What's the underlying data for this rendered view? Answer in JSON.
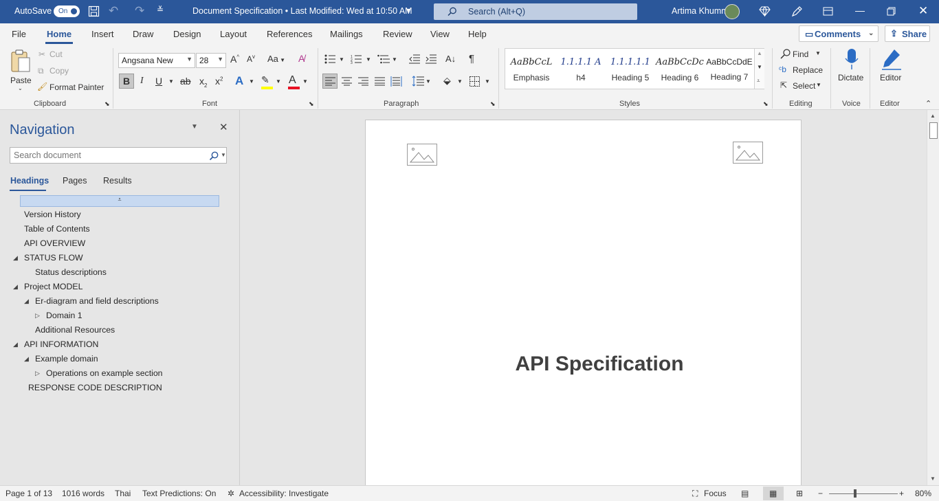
{
  "titlebar": {
    "autosave_label": "AutoSave",
    "autosave_state": "On",
    "doc_title": "Document Specification • Last Modified: Wed at 10:50 AM",
    "search_placeholder": "Search (Alt+Q)",
    "user_name": "Artima Khummee"
  },
  "menu": {
    "items": [
      "File",
      "Home",
      "Insert",
      "Draw",
      "Design",
      "Layout",
      "References",
      "Mailings",
      "Review",
      "View",
      "Help"
    ],
    "active": "Home",
    "comments_label": "Comments",
    "share_label": "Share"
  },
  "ribbon": {
    "clipboard": {
      "paste": "Paste",
      "cut": "Cut",
      "copy": "Copy",
      "format_painter": "Format Painter",
      "label": "Clipboard"
    },
    "font": {
      "name": "Angsana New",
      "size": "28",
      "label": "Font",
      "case_label": "Aa"
    },
    "paragraph": {
      "label": "Paragraph"
    },
    "styles": {
      "label": "Styles",
      "items": [
        {
          "preview": "AaBbCcL",
          "name": "Emphasis"
        },
        {
          "preview": "1.1.1.1 A",
          "name": "h4"
        },
        {
          "preview": "1.1.1.1.1",
          "name": "Heading 5"
        },
        {
          "preview": "AaBbCcDc",
          "name": "Heading 6"
        },
        {
          "preview": "AaBbCcDdE",
          "name": "Heading 7"
        }
      ]
    },
    "editing": {
      "find": "Find",
      "replace": "Replace",
      "select": "Select",
      "label": "Editing"
    },
    "voice": {
      "dictate": "Dictate",
      "label": "Voice"
    },
    "editor": {
      "editor": "Editor",
      "label": "Editor"
    },
    "colors": {
      "highlight": "#ffff00",
      "font_color": "#e81123",
      "accent": "#2b579a"
    }
  },
  "nav": {
    "title": "Navigation",
    "search_placeholder": "Search document",
    "tabs": [
      "Headings",
      "Pages",
      "Results"
    ],
    "active_tab": "Headings",
    "headings": [
      {
        "text": "Version History"
      },
      {
        "text": "Table of Contents"
      },
      {
        "text": "API OVERVIEW"
      },
      {
        "text": "STATUS FLOW",
        "toggle": "expanded"
      },
      {
        "text": "Status descriptions"
      },
      {
        "text": "Project MODEL",
        "toggle": "expanded"
      },
      {
        "text": "Er-diagram and field descriptions",
        "toggle": "expanded"
      },
      {
        "text": "Domain 1",
        "toggle": "collapsed"
      },
      {
        "text": "Additional Resources"
      },
      {
        "text": "API INFORMATION",
        "toggle": "expanded"
      },
      {
        "text": "Example domain",
        "toggle": "expanded"
      },
      {
        "text": "Operations on example section",
        "toggle": "collapsed"
      },
      {
        "text": "RESPONSE CODE DESCRIPTION"
      }
    ]
  },
  "document": {
    "title": "API Specification"
  },
  "status": {
    "page": "Page 1 of 13",
    "words": "1016 words",
    "language": "Thai",
    "text_predictions": "Text Predictions: On",
    "accessibility": "Accessibility: Investigate",
    "focus": "Focus",
    "zoom": "80%"
  }
}
